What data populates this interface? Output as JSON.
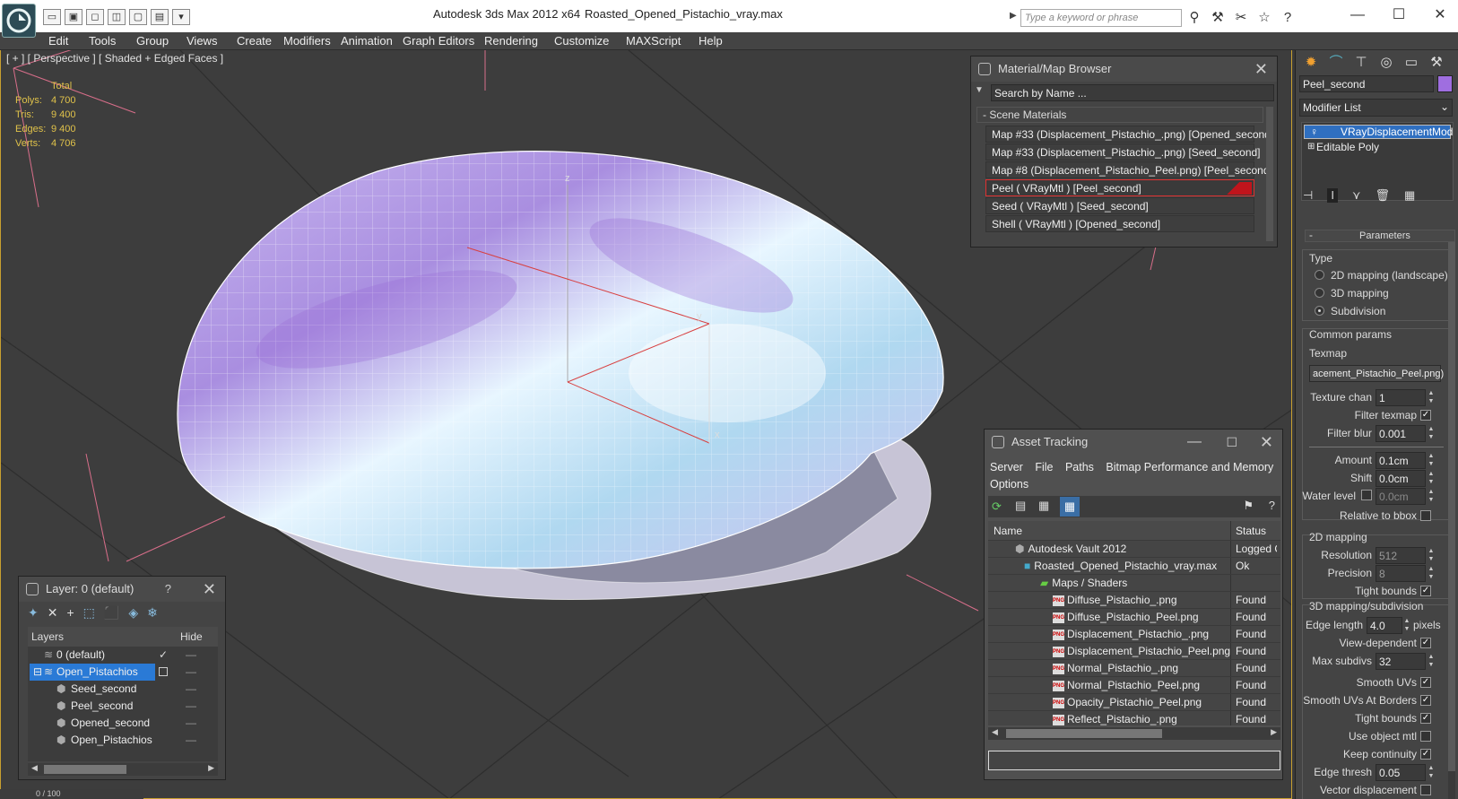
{
  "app": {
    "title": "Autodesk 3ds Max  2012 x64",
    "filename": "Roasted_Opened_Pistachio_vray.max",
    "search_placeholder": "Type a keyword or phrase"
  },
  "menu": [
    "Edit",
    "Tools",
    "Group",
    "Views",
    "Create",
    "Modifiers",
    "Animation",
    "Graph Editors",
    "Rendering",
    "Customize",
    "MAXScript",
    "Help"
  ],
  "viewport": {
    "label": "[ + ] [ Perspective ] [ Shaded + Edged Faces ]",
    "stats_header": "Total",
    "stats": [
      {
        "k": "Polys:",
        "v": "4 700"
      },
      {
        "k": "Tris:",
        "v": "9 400"
      },
      {
        "k": "Edges:",
        "v": "9 400"
      },
      {
        "k": "Verts:",
        "v": "4 706"
      }
    ],
    "axis_z": "z",
    "axis_y": "y",
    "axis_x": "x"
  },
  "material_browser": {
    "title": "Material/Map Browser",
    "search_placeholder": "Search by Name ...",
    "section": "- Scene Materials",
    "items": [
      "Map #33 (Displacement_Pistachio_.png) [Opened_second]",
      "Map #33 (Displacement_Pistachio_.png) [Seed_second]",
      "Map #8 (Displacement_Pistachio_Peel.png) [Peel_second]",
      "Peel  ( VRayMtl ) [Peel_second]",
      "Seed  ( VRayMtl ) [Seed_second]",
      "Shell  ( VRayMtl ) [Opened_second]"
    ],
    "selected_index": 3
  },
  "asset_tracking": {
    "title": "Asset Tracking",
    "menu": [
      "Server",
      "File",
      "Paths",
      "Bitmap Performance and Memory",
      "Options"
    ],
    "col_name": "Name",
    "col_status": "Status",
    "rows": [
      {
        "name": "Autodesk Vault 2012",
        "status": "Logged O",
        "indent": 1,
        "icon": "vault"
      },
      {
        "name": "Roasted_Opened_Pistachio_vray.max",
        "status": "Ok",
        "indent": 2,
        "icon": "max"
      },
      {
        "name": "Maps / Shaders",
        "status": "",
        "indent": 3,
        "icon": "maps"
      },
      {
        "name": "Diffuse_Pistachio_.png",
        "status": "Found",
        "indent": 4,
        "icon": "png"
      },
      {
        "name": "Diffuse_Pistachio_Peel.png",
        "status": "Found",
        "indent": 4,
        "icon": "png"
      },
      {
        "name": "Displacement_Pistachio_.png",
        "status": "Found",
        "indent": 4,
        "icon": "png"
      },
      {
        "name": "Displacement_Pistachio_Peel.png",
        "status": "Found",
        "indent": 4,
        "icon": "png"
      },
      {
        "name": "Normal_Pistachio_.png",
        "status": "Found",
        "indent": 4,
        "icon": "png"
      },
      {
        "name": "Normal_Pistachio_Peel.png",
        "status": "Found",
        "indent": 4,
        "icon": "png"
      },
      {
        "name": "Opacity_Pistachio_Peel.png",
        "status": "Found",
        "indent": 4,
        "icon": "png"
      },
      {
        "name": "Reflect_Pistachio_.png",
        "status": "Found",
        "indent": 4,
        "icon": "png"
      }
    ]
  },
  "layer_panel": {
    "title": "Layer: 0 (default)",
    "help": "?",
    "col_layers": "Layers",
    "col_hide": "Hide",
    "rows": [
      {
        "name": "0 (default)",
        "indent": 1,
        "selected": false,
        "check": true
      },
      {
        "name": "Open_Pistachios",
        "indent": 1,
        "selected": true,
        "check": false
      },
      {
        "name": "Seed_second",
        "indent": 2,
        "selected": false,
        "check": false
      },
      {
        "name": "Peel_second",
        "indent": 2,
        "selected": false,
        "check": false
      },
      {
        "name": "Opened_second",
        "indent": 2,
        "selected": false,
        "check": false
      },
      {
        "name": "Open_Pistachios",
        "indent": 2,
        "selected": false,
        "check": false
      }
    ]
  },
  "command_panel": {
    "object_name": "Peel_second",
    "object_color": "#9f6ee0",
    "modifier_list": "Modifier List",
    "stack": [
      "VRayDisplacementMod",
      "Editable Poly"
    ],
    "params_title": "Parameters",
    "type_label": "Type",
    "type_options": [
      "2D mapping (landscape)",
      "3D mapping",
      "Subdivision"
    ],
    "type_selected": 2,
    "common_params": "Common params",
    "texmap_label": "Texmap",
    "texmap_value": "acement_Pistachio_Peel.png)",
    "texture_chan_label": "Texture chan",
    "texture_chan": "1",
    "filter_texmap": "Filter texmap",
    "filter_blur_label": "Filter blur",
    "filter_blur": "0.001",
    "amount_label": "Amount",
    "amount": "0.1cm",
    "shift_label": "Shift",
    "shift": "0.0cm",
    "water_level_label": "Water level",
    "water_level": "0.0cm",
    "relative_bbox": "Relative to bbox",
    "mapping2d": "2D mapping",
    "resolution_label": "Resolution",
    "resolution": "512",
    "precision_label": "Precision",
    "precision": "8",
    "tight_bounds": "Tight bounds",
    "mapping3d": "3D mapping/subdivision",
    "edge_length_label": "Edge length",
    "edge_length": "4.0",
    "pixels": "pixels",
    "view_dependent": "View-dependent",
    "max_subdivs_label": "Max subdivs",
    "max_subdivs": "32",
    "smooth_uvs": "Smooth UVs",
    "smooth_uvs_borders": "Smooth UVs At Borders",
    "tight_bounds2": "Tight bounds",
    "use_object_mtl": "Use object mtl",
    "keep_continuity": "Keep continuity",
    "edge_thresh_label": "Edge thresh",
    "edge_thresh": "0.05",
    "vector_displacement": "Vector displacement"
  },
  "status": {
    "frames": "0 / 100"
  }
}
